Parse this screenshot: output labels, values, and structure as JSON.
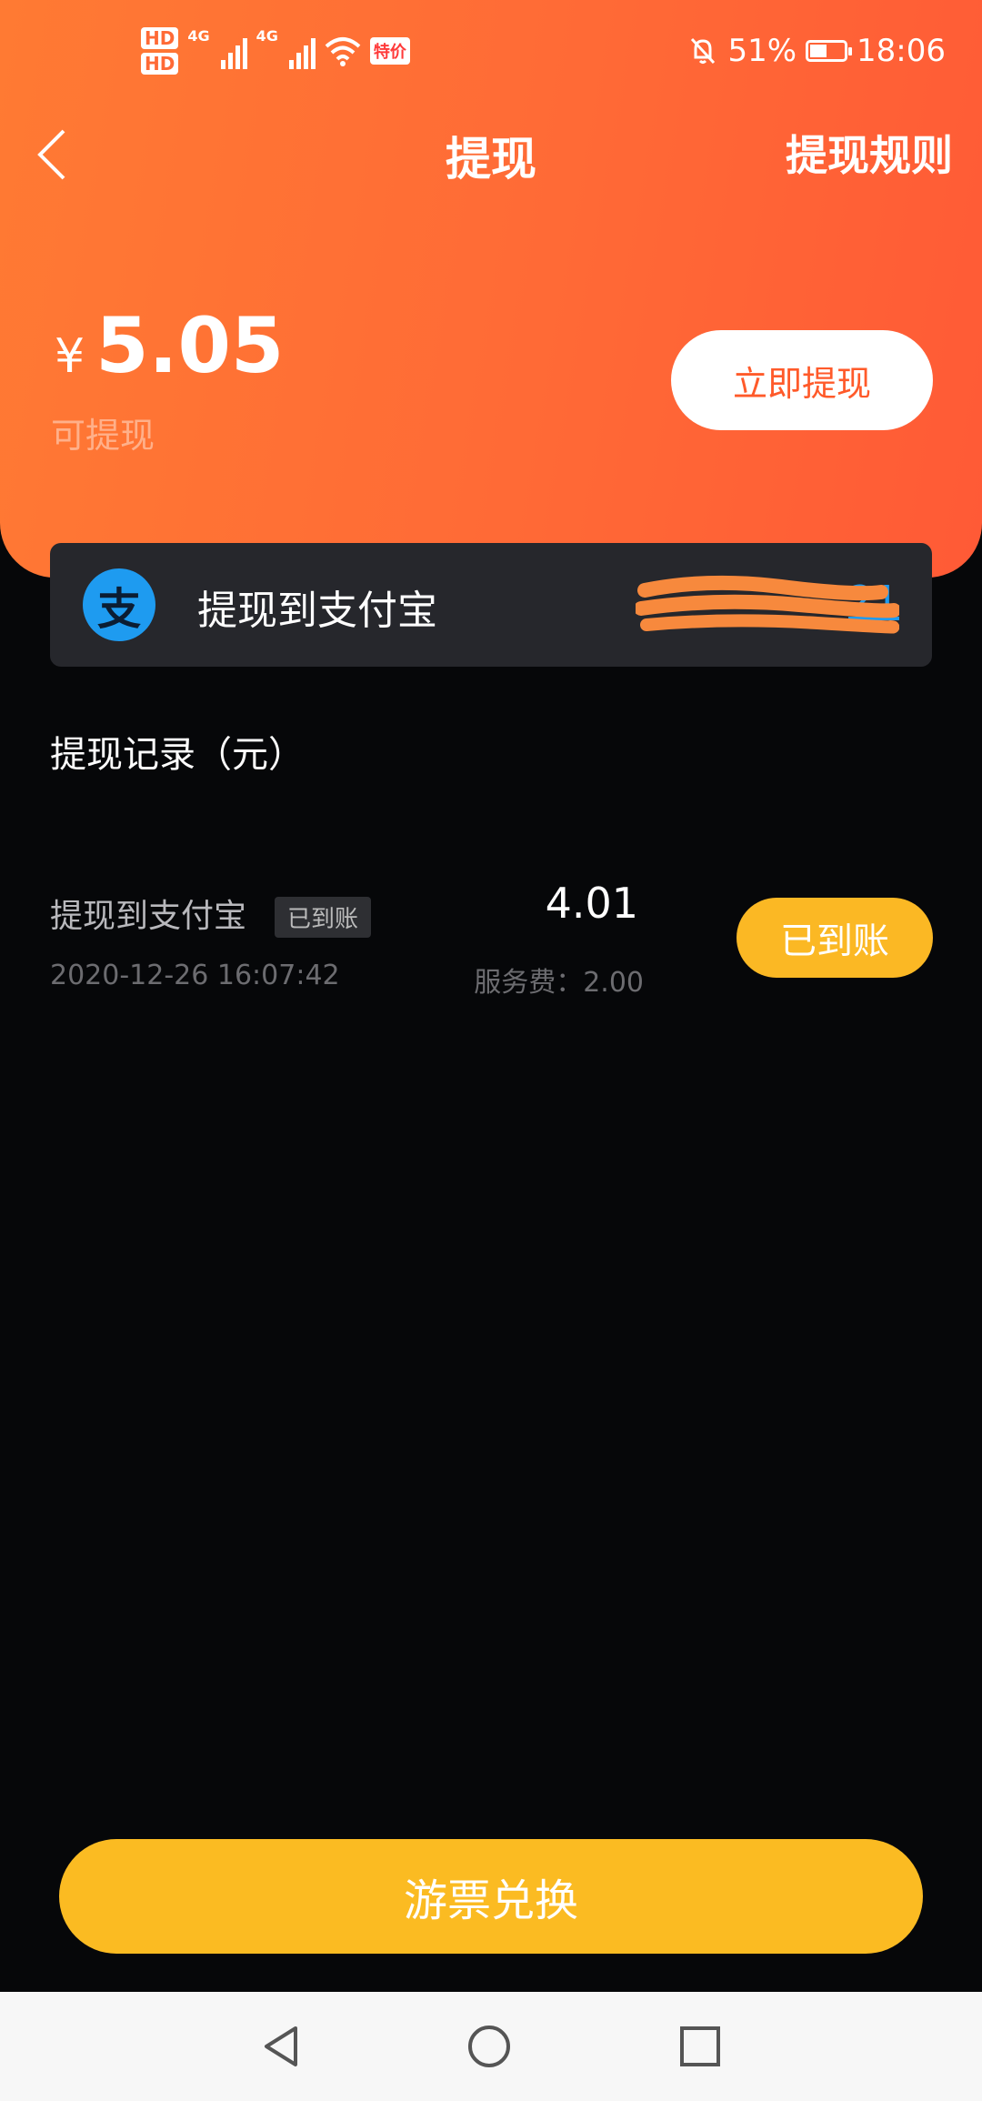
{
  "status_bar": {
    "hd1": "HD",
    "hd2": "HD",
    "net1": "4G",
    "net2": "4G",
    "carrier_badge": "特价",
    "battery_pct": "51%",
    "battery_level": 0.51,
    "time": "18:06"
  },
  "nav": {
    "title": "提现",
    "rules_label": "提现规则"
  },
  "balance": {
    "currency": "¥",
    "amount": "5.05",
    "label": "可提现",
    "withdraw_button": "立即提现"
  },
  "alipay": {
    "logo_glyph": "支",
    "label": "提现到支付宝",
    "account_suffix": "21"
  },
  "records": {
    "title": "提现记录（元）",
    "items": [
      {
        "desc": "提现到支付宝",
        "tag": "已到账",
        "date": "2020-12-26 16:07:42",
        "amount": "4.01",
        "fee": "服务费：2.00",
        "status": "已到账"
      }
    ]
  },
  "exchange_button": "游票兑换",
  "colors": {
    "header_orange": "#ff6a36",
    "accent_yellow": "#fbbb22",
    "alipay_blue": "#1e9bf0",
    "background": "#060709"
  }
}
